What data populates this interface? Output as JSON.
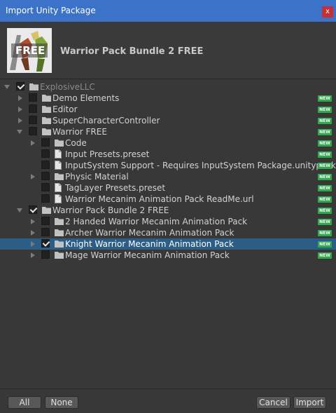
{
  "window": {
    "title": "Import Unity Package",
    "close_label": "x"
  },
  "package": {
    "title": "Warrior Pack Bundle 2 FREE",
    "logo_text": "FREE"
  },
  "new_badge": "NEW",
  "tree": [
    {
      "label": "ExplosiveLLC",
      "depth": 0,
      "expander": "down",
      "checked": true,
      "icon": "folder",
      "dim": true,
      "new": false
    },
    {
      "label": "Demo Elements",
      "depth": 1,
      "expander": "right",
      "checked": false,
      "icon": "folder",
      "new": true
    },
    {
      "label": "Editor",
      "depth": 1,
      "expander": "right",
      "checked": false,
      "icon": "folder",
      "new": true
    },
    {
      "label": "SuperCharacterController",
      "depth": 1,
      "expander": "right",
      "checked": false,
      "icon": "folder",
      "new": true
    },
    {
      "label": "Warrior FREE",
      "depth": 1,
      "expander": "down",
      "checked": false,
      "icon": "folder",
      "new": true
    },
    {
      "label": "Code",
      "depth": 2,
      "expander": "right",
      "checked": false,
      "icon": "folder",
      "new": true
    },
    {
      "label": "Input Presets.preset",
      "depth": 2,
      "expander": "none",
      "checked": false,
      "icon": "file",
      "new": true
    },
    {
      "label": "InputSystem Support - Requires InputSystem Package.unitypackage",
      "depth": 2,
      "expander": "none",
      "checked": false,
      "icon": "file",
      "new": true
    },
    {
      "label": "Physic Material",
      "depth": 2,
      "expander": "right",
      "checked": false,
      "icon": "folder",
      "new": true
    },
    {
      "label": "TagLayer Presets.preset",
      "depth": 2,
      "expander": "none",
      "checked": false,
      "icon": "file",
      "new": true
    },
    {
      "label": "Warrior Mecanim Animation Pack ReadMe.url",
      "depth": 2,
      "expander": "none",
      "checked": false,
      "icon": "file",
      "new": true
    },
    {
      "label": "Warrior Pack Bundle 2 FREE",
      "depth": 1,
      "expander": "down",
      "checked": true,
      "icon": "folder",
      "new": true
    },
    {
      "label": "2 Handed Warrior Mecanim Animation Pack",
      "depth": 2,
      "expander": "right",
      "checked": false,
      "icon": "folder",
      "new": true
    },
    {
      "label": "Archer Warrior Mecanim Animation Pack",
      "depth": 2,
      "expander": "right",
      "checked": false,
      "icon": "folder",
      "new": true
    },
    {
      "label": "Knight Warrior Mecanim Animation Pack",
      "depth": 2,
      "expander": "right",
      "checked": true,
      "icon": "folder",
      "new": true,
      "selected": true
    },
    {
      "label": "Mage Warrior Mecanim Animation Pack",
      "depth": 2,
      "expander": "right",
      "checked": false,
      "icon": "folder",
      "new": true
    }
  ],
  "footer": {
    "all_label": "All",
    "none_label": "None",
    "cancel_label": "Cancel",
    "import_label": "Import"
  },
  "colors": {
    "titlebar": "#3c73c8",
    "selection": "#2c5d87",
    "new_badge": "#2ea84a",
    "close": "#c43038"
  }
}
